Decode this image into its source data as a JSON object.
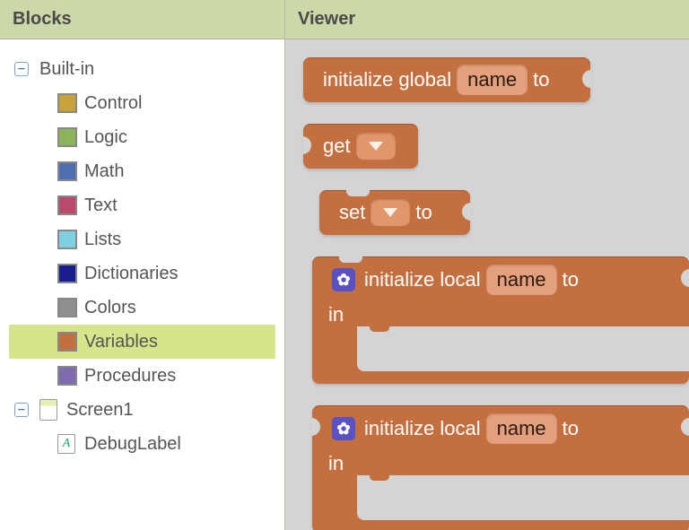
{
  "panels": {
    "blocks_title": "Blocks",
    "viewer_title": "Viewer"
  },
  "tree": {
    "builtin_label": "Built-in",
    "categories": [
      {
        "label": "Control",
        "color": "#c7a33a"
      },
      {
        "label": "Logic",
        "color": "#8bb357"
      },
      {
        "label": "Math",
        "color": "#4f6fb3"
      },
      {
        "label": "Text",
        "color": "#b94a6b"
      },
      {
        "label": "Lists",
        "color": "#7fd0e0"
      },
      {
        "label": "Dictionaries",
        "color": "#1a1d8c"
      },
      {
        "label": "Colors",
        "color": "#8f8f8f"
      },
      {
        "label": "Variables",
        "color": "#c46f3f",
        "selected": true
      },
      {
        "label": "Procedures",
        "color": "#7e6bb0"
      }
    ],
    "screen_label": "Screen1",
    "screen_child": "DebugLabel"
  },
  "blocks": {
    "init_global": {
      "prefix": "initialize global",
      "field": "name",
      "suffix": "to"
    },
    "get": {
      "label": "get"
    },
    "set": {
      "label": "set",
      "suffix": "to"
    },
    "local1": {
      "prefix": "initialize local",
      "field": "name",
      "suffix": "to",
      "in": "in"
    },
    "local2": {
      "prefix": "initialize local",
      "field": "name",
      "suffix": "to",
      "in": "in"
    }
  },
  "icons": {
    "gear": "✿",
    "label_glyph": "A"
  }
}
